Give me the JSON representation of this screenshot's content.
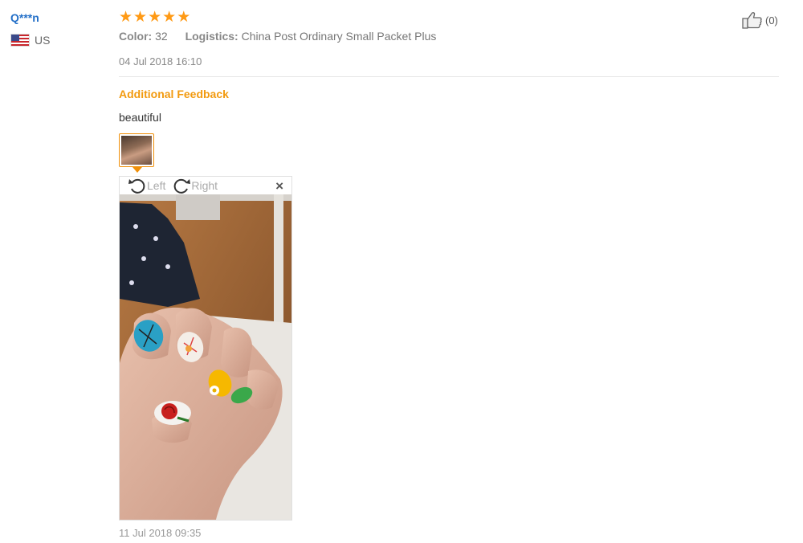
{
  "review": {
    "user_name": "Q***n",
    "country_code": "US",
    "rating_stars": 5,
    "color_label": "Color:",
    "color_value": "32",
    "logistics_label": "Logistics:",
    "logistics_value": "China Post Ordinary Small Packet Plus",
    "date": "04 Jul 2018 16:10",
    "like_count": "(0)",
    "additional_feedback_title": "Additional Feedback",
    "additional_feedback_text": "beautiful",
    "additional_feedback_date": "11 Jul 2018 09:35",
    "image_viewer": {
      "rotate_left_label": "Left",
      "rotate_right_label": "Right",
      "close_symbol": "×"
    }
  },
  "colors": {
    "user_name": "#2470c8",
    "star": "#ff9a15",
    "accent_orange": "#f29a0f"
  }
}
